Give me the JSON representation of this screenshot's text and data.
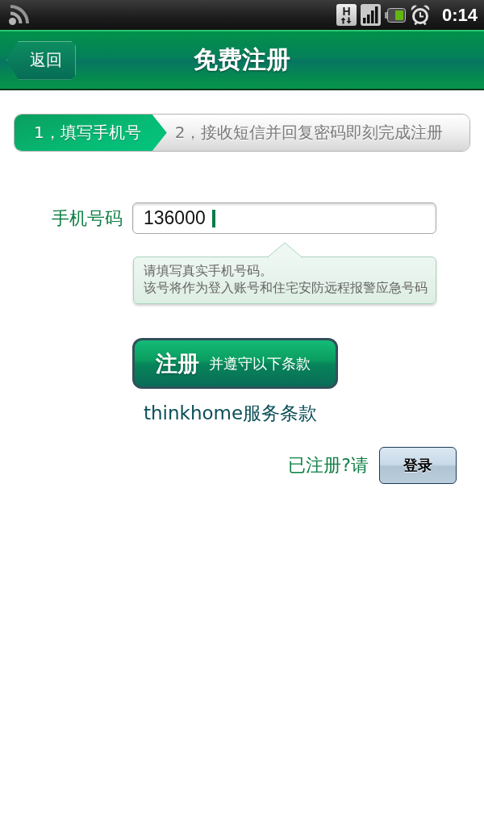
{
  "status_bar": {
    "network_type": "H",
    "time": "0:14"
  },
  "header": {
    "back_button": "返回",
    "title": "免费注册"
  },
  "steps": [
    {
      "label": "1，填写手机号",
      "selected": true
    },
    {
      "label": "2，接收短信并回复密码即刻完成注册",
      "selected": false
    }
  ],
  "phone_field": {
    "label": "手机号码",
    "value": "136000",
    "focused": true
  },
  "hint": [
    "请填写真实手机号码。",
    "该号将作为登入账号和住宅安防远程报警应急号码"
  ],
  "register_button": {
    "label": "注册",
    "note": "并遵守以下条款"
  },
  "terms_link": "thinkhome服务条款",
  "login": {
    "prompt": "已注册?请",
    "button": "登录"
  }
}
